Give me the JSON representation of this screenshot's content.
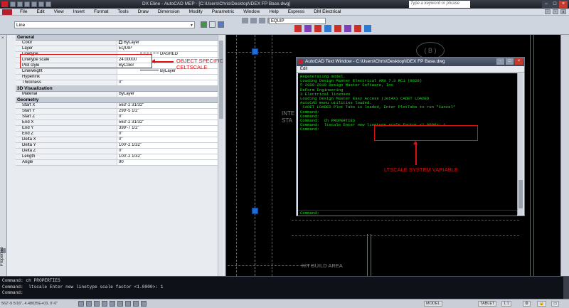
{
  "window": {
    "title": "DX Eline - AutoCAD MEP - [C:\\Users\\Chris\\Desktop\\IDEX FP Base.dwg]",
    "help_search_placeholder": "Type a keyword or phrase"
  },
  "menu": [
    "File",
    "Edit",
    "View",
    "Insert",
    "Format",
    "Tools",
    "Draw",
    "Dimension",
    "Modify",
    "Parametric",
    "Window",
    "Help",
    "Express",
    "DM Electrical"
  ],
  "toolbar": {
    "object_select": "Line",
    "layer": "EQUIP"
  },
  "palette": {
    "side_label": "Properties",
    "sections": [
      {
        "name": "General",
        "rows": [
          {
            "label": "Color",
            "value": "ByLayer"
          },
          {
            "label": "Layer",
            "value": "EQUIP"
          },
          {
            "label": "Linetype",
            "value": "DASHED"
          },
          {
            "label": "Linetype scale",
            "value": "24.00000"
          },
          {
            "label": "Plot style",
            "value": "ByColor"
          },
          {
            "label": "Lineweight",
            "value": "ByLayer"
          },
          {
            "label": "Hyperlink",
            "value": ""
          },
          {
            "label": "Thickness",
            "value": "0\""
          }
        ]
      },
      {
        "name": "3D Visualization",
        "rows": [
          {
            "label": "Material",
            "value": "ByLayer"
          }
        ]
      },
      {
        "name": "Geometry",
        "rows": [
          {
            "label": "Start X",
            "value": "563'-2 31/32\""
          },
          {
            "label": "Start Y",
            "value": "299'-5 1/2\""
          },
          {
            "label": "Start Z",
            "value": "0\""
          },
          {
            "label": "End X",
            "value": "563'-2 31/32\""
          },
          {
            "label": "End Y",
            "value": "399'-7 1/2\""
          },
          {
            "label": "End Z",
            "value": "0\""
          },
          {
            "label": "Delta X",
            "value": "0\""
          },
          {
            "label": "Delta Y",
            "value": "100'-2 1/32\""
          },
          {
            "label": "Delta Z",
            "value": "0\""
          },
          {
            "label": "Length",
            "value": "100'-2 1/32\""
          },
          {
            "label": "Angle",
            "value": "90"
          }
        ]
      }
    ]
  },
  "annotations": {
    "celtscale_line1": "OBJECT SPECIFIC",
    "celtscale_line2": "CELTSCALE",
    "ltscale_label": "LTSCALE SYSTEM VARIABLE"
  },
  "drawing": {
    "grid_bubble": "( B )",
    "text_inter": "INTE",
    "text_sta": "STA",
    "text_kit": "KIT   BUILD   AREA"
  },
  "text_window": {
    "title": "AutoCAD Text Window - C:\\Users\\Chris\\Desktop\\IDEX FP Base.dwg",
    "menu_edit": "Edit",
    "lines": [
      "Regenerating model.",
      "",
      "Loading Design Master Electrical ARX 7.3 RC1 (8828)",
      "© 2000-2010 Design Master Software, Inc",
      "DeForm Engineering",
      "3 Electrical licenses",
      "Loading Design Master Easy Access (Jet4X) CADET LOADED",
      "AutoCAD menu utilities loaded.",
      " CADET LOADED Plot Tabs is loaded, Enter PlotTabs to run *Cancel*",
      "",
      "Command:",
      "Command:",
      "Command:  ch PROPERTIES",
      "Command:  ltscale Enter new linetype scale factor <1.0000>: 1",
      "",
      "Command:"
    ],
    "input": "Command:"
  },
  "command_line": {
    "lines": [
      "Command: ch PROPERTIES",
      "Command:  ltscale Enter new linetype scale factor <1.0000>: 1",
      "Command:"
    ]
  },
  "statusbar": {
    "coords": "562'-9 5/16\", 4.48035E+03, 0'-0\"",
    "model": "MODEL",
    "tablet": "TABLET",
    "scale": "1:1"
  }
}
